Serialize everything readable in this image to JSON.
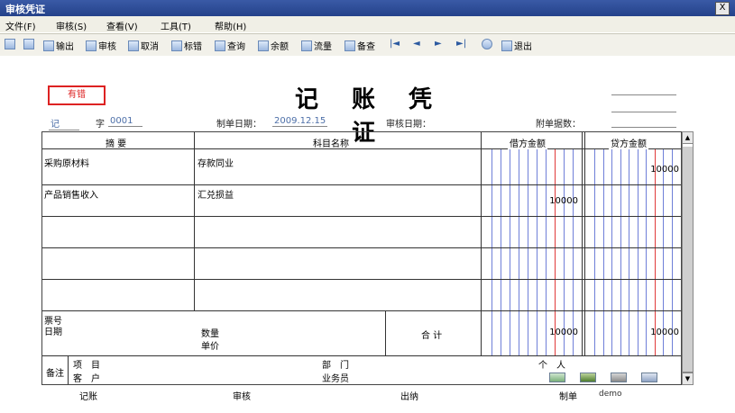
{
  "window": {
    "title": "审核凭证",
    "close_label": "X"
  },
  "menu": [
    "文件(F)",
    "审核(S)",
    "查看(V)",
    "工具(T)",
    "帮助(H)"
  ],
  "toolbar": {
    "items": [
      {
        "label": "",
        "icon": "print-icon"
      },
      {
        "label": "",
        "icon": "preview-icon"
      },
      {
        "label": "输出",
        "icon": "output-icon"
      },
      {
        "label": "审核",
        "icon": "audit-icon"
      },
      {
        "label": "取消",
        "icon": "cancel-icon"
      },
      {
        "label": "标错",
        "icon": "mark-error-icon"
      },
      {
        "label": "查询",
        "icon": "query-icon"
      },
      {
        "label": "余额",
        "icon": "balance-icon"
      },
      {
        "label": "流量",
        "icon": "cash-flow-icon"
      },
      {
        "label": "备查",
        "icon": "memo-icon"
      }
    ],
    "nav_icons": [
      "first-icon",
      "previous-icon",
      "next-icon",
      "last-icon",
      "help-icon"
    ],
    "exit_label": "退出"
  },
  "voucher": {
    "status_stamp": "有错",
    "title": "记 账 凭 证",
    "type_label": "记",
    "number_label": "字",
    "number": "0001",
    "date_label": "制单日期：",
    "date": "2009.12.15",
    "audit_date_label": "审核日期：",
    "attachments_label": "附单据数："
  },
  "table": {
    "headers": {
      "summary": "摘 要",
      "account": "科目名称",
      "debit": "借方金额",
      "credit": "贷方金额"
    },
    "rows": [
      {
        "summary": "采购原材料",
        "account": "存款同业",
        "debit": "",
        "credit": "10000"
      },
      {
        "summary": "产品销售收入",
        "account": "汇兑损益",
        "debit": "10000",
        "credit": ""
      },
      {
        "summary": "",
        "account": "",
        "debit": "",
        "credit": ""
      },
      {
        "summary": "",
        "account": "",
        "debit": "",
        "credit": ""
      },
      {
        "summary": "",
        "account": "",
        "debit": "",
        "credit": ""
      }
    ],
    "footer": {
      "ticket_no_label": "票号",
      "date_label": "日期",
      "quantity_label": "数量",
      "unit_price_label": "单价",
      "total_label": "合 计",
      "total_debit": "10000",
      "total_credit": "10000"
    },
    "notes": {
      "remark_label": "备注",
      "project_label": "项　目",
      "department_label": "部　门",
      "person_label": "个　人",
      "customer_label": "客　户",
      "salesman_label": "业务员"
    }
  },
  "signatures": {
    "bookkeeper_label": "记账",
    "auditor_label": "审核",
    "cashier_label": "出纳",
    "maker_label": "制单",
    "maker_name": "demo"
  },
  "colors": {
    "title_bar": "#2a4a94",
    "stamp": "#dd2222",
    "grid_blue": "#6f7fd8",
    "grid_red": "#e03a3a"
  }
}
